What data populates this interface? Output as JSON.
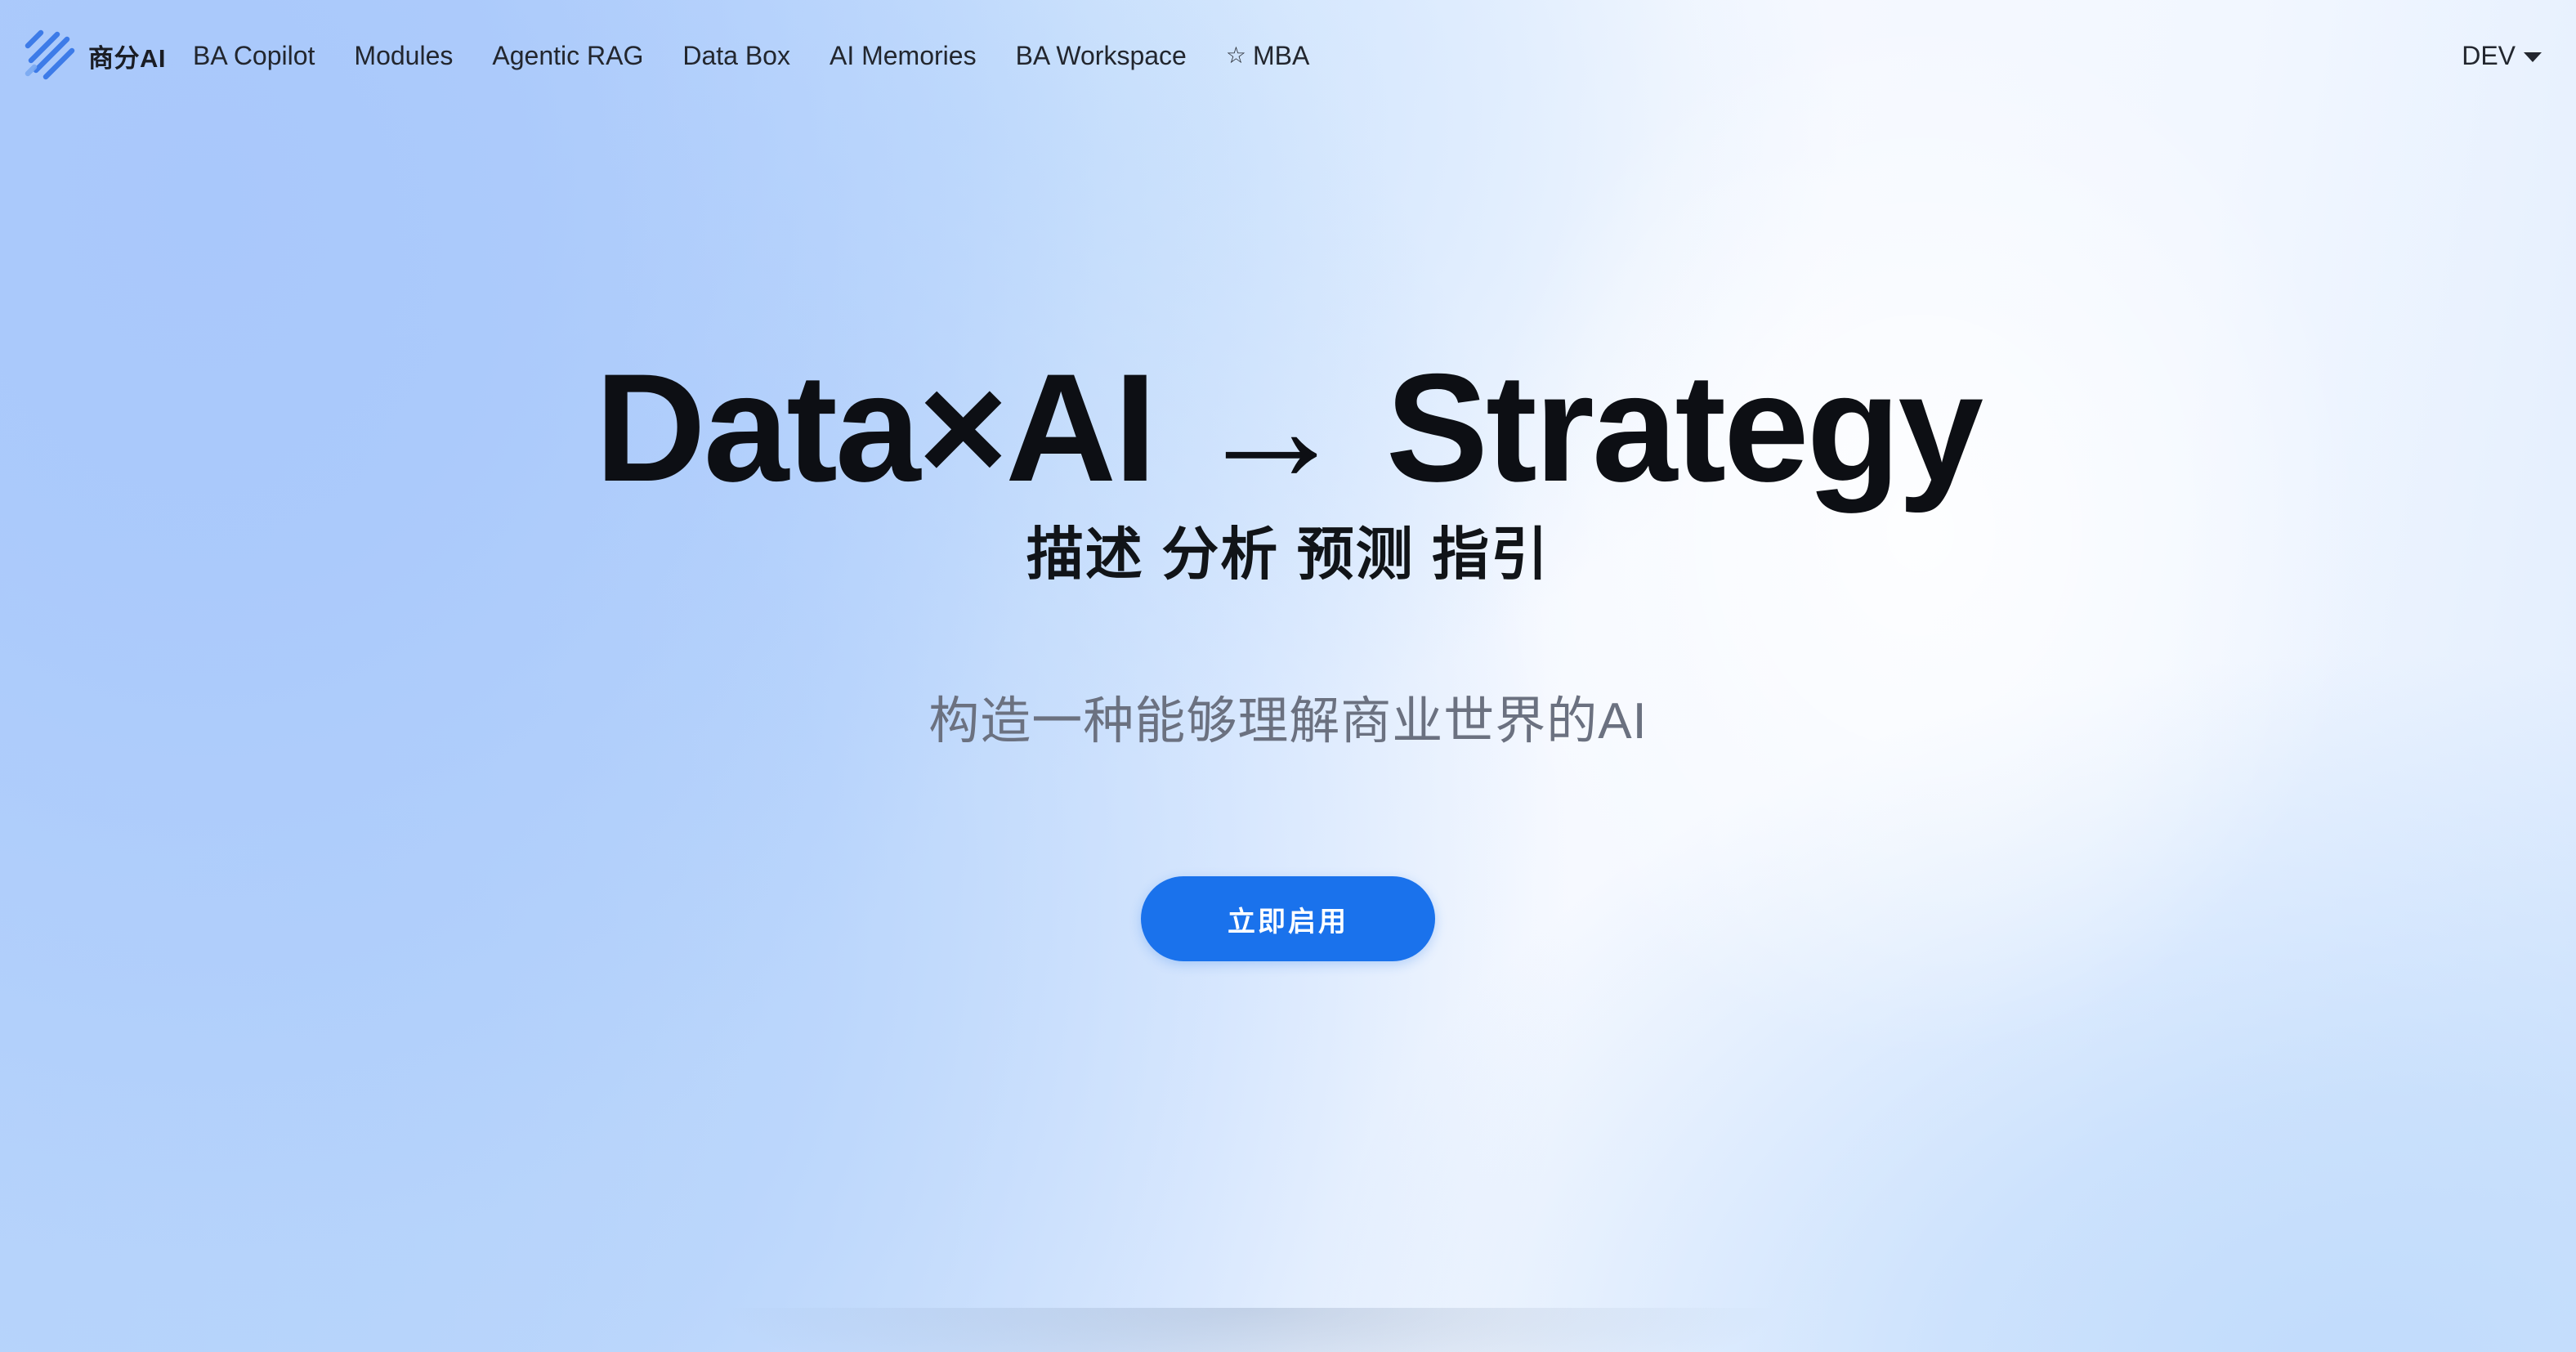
{
  "brand": {
    "name": "商分AI",
    "logo_icon": "stripes-logo-icon",
    "logo_color": "#3d7be8"
  },
  "nav": {
    "items": [
      {
        "label": "BA Copilot"
      },
      {
        "label": "Modules"
      },
      {
        "label": "Agentic RAG"
      },
      {
        "label": "Data Box"
      },
      {
        "label": "AI Memories"
      },
      {
        "label": "BA Workspace"
      },
      {
        "label": "MBA",
        "icon": "star-outline-icon",
        "glyph": "☆"
      }
    ],
    "env": {
      "label": "DEV",
      "icon": "caret-down-icon"
    }
  },
  "hero": {
    "title": "Data×AI → Strategy",
    "subtitle": "描述 分析 预测 指引",
    "tagline": "构造一种能够理解商业世界的AI",
    "cta_label": "立即启用"
  },
  "colors": {
    "accent": "#1a72ec",
    "text_primary": "#0d0f14",
    "text_muted": "#6b7180"
  }
}
